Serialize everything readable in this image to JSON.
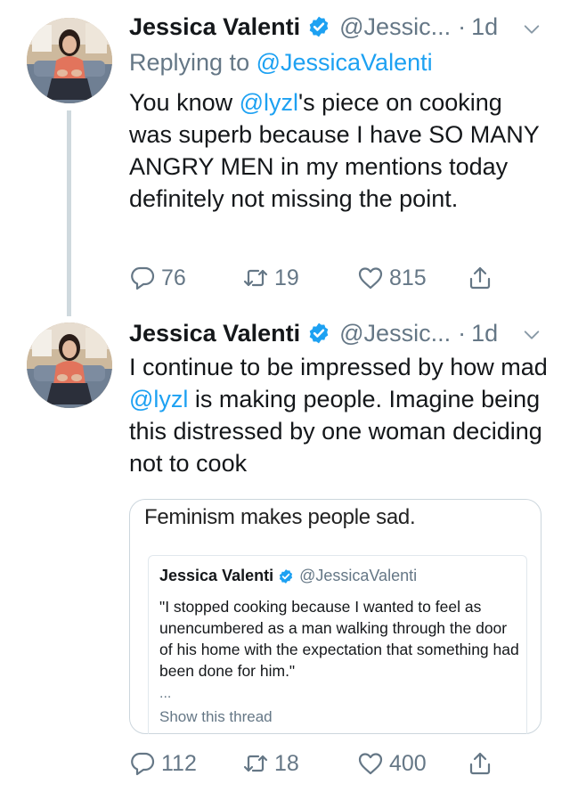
{
  "tweets": [
    {
      "name": "Jessica Valenti",
      "handle": "@Jessic...",
      "separator": "·",
      "time": "1d",
      "reply_prefix": "Replying to",
      "reply_handle": "@JessicaValenti",
      "body_before": "You know ",
      "body_mention": "@lyzl",
      "body_after": "'s piece on cooking was superb because I have SO MANY ANGRY MEN in my mentions today definitely not missing the point.",
      "replies": "76",
      "retweets": "19",
      "likes": "815"
    },
    {
      "name": "Jessica Valenti",
      "handle": "@Jessic...",
      "separator": "·",
      "time": "1d",
      "body_before": "I continue to be impressed by how mad ",
      "body_mention": "@lyzl",
      "body_after": " is making people. Imagine being this distressed by one woman deciding not to cook",
      "quote": {
        "text": "Feminism makes people sad.",
        "inner_name": "Jessica Valenti",
        "inner_handle": "@JessicaValenti",
        "inner_body": "\"I stopped cooking because I wanted to feel as unencumbered as a man walking through the door of his home with the expectation that something had been done for him.\"",
        "inner_ellipsis": "...",
        "inner_link": "Show this thread"
      },
      "replies": "112",
      "retweets": "18",
      "likes": "400"
    }
  ],
  "colors": {
    "link": "#1da1f2",
    "muted": "#657786",
    "text": "#14171a",
    "thread_line": "#cfd9de"
  },
  "icons": [
    "verified-badge-icon",
    "chevron-down-icon",
    "reply-icon",
    "retweet-icon",
    "like-icon",
    "share-icon"
  ]
}
